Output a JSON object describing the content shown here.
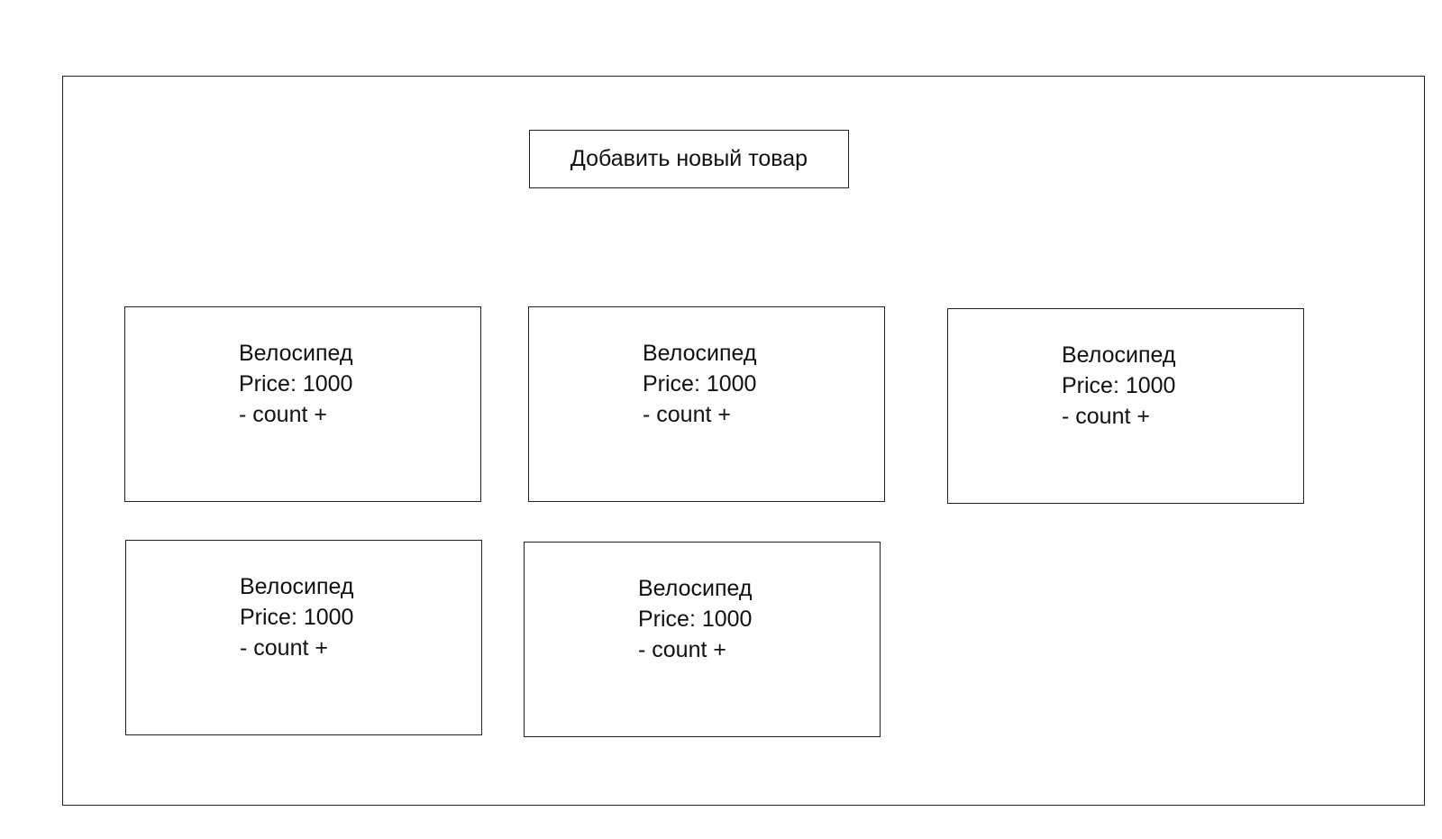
{
  "toolbar": {
    "add_product_label": "Добавить новый товар"
  },
  "products": [
    {
      "name": "Велосипед",
      "price_label": "Price: 1000",
      "minus": "-",
      "count_label": "count",
      "plus": "+"
    },
    {
      "name": "Велосипед",
      "price_label": "Price: 1000",
      "minus": "-",
      "count_label": "count",
      "plus": "+"
    },
    {
      "name": "Велосипед",
      "price_label": "Price: 1000",
      "minus": "-",
      "count_label": "count",
      "plus": "+"
    },
    {
      "name": "Велосипед",
      "price_label": "Price: 1000",
      "minus": "-",
      "count_label": "count",
      "plus": "+"
    },
    {
      "name": "Велосипед",
      "price_label": "Price: 1000",
      "minus": "-",
      "count_label": "count",
      "plus": "+"
    }
  ]
}
